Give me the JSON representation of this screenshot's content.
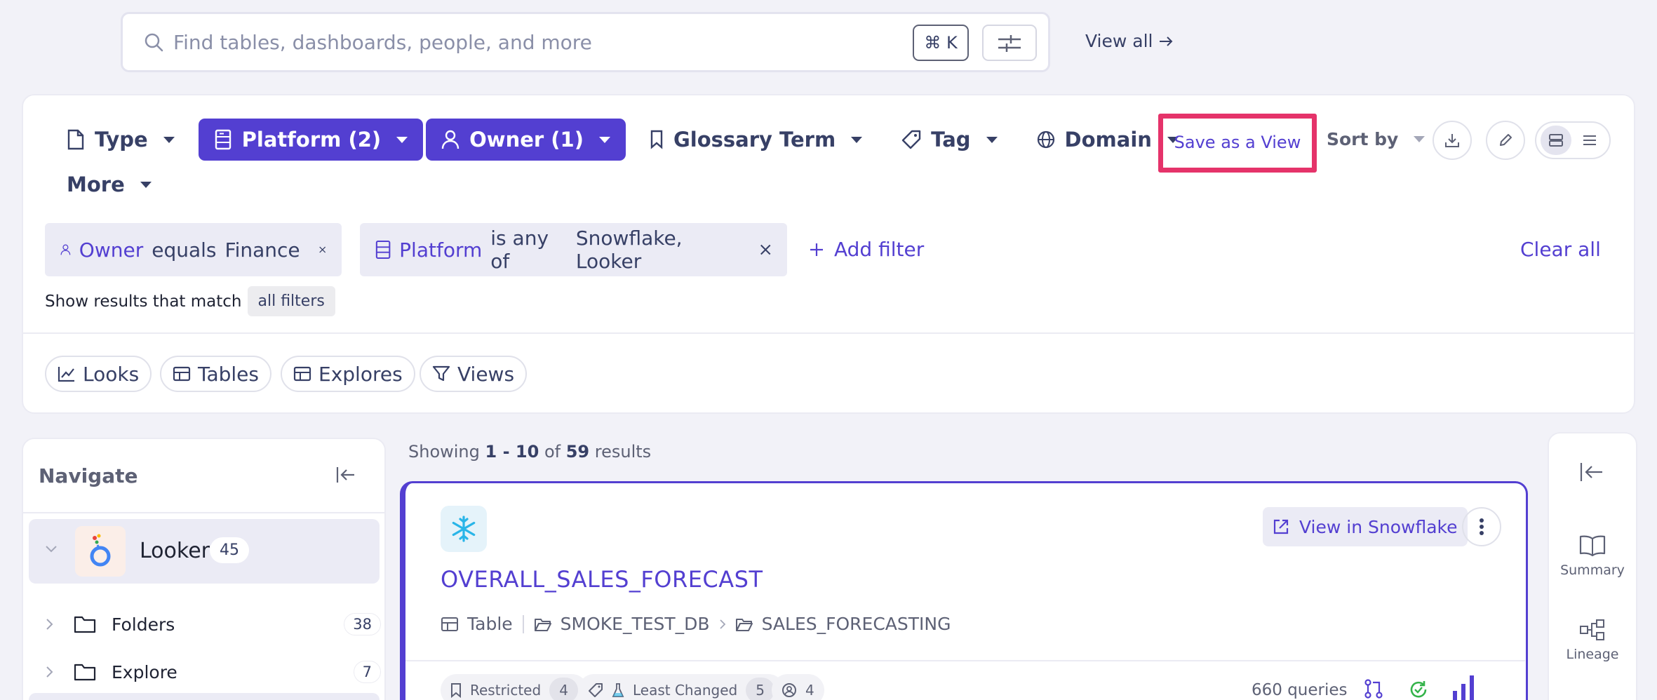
{
  "search": {
    "placeholder": "Find tables, dashboards, people, and more",
    "shortcut": "⌘ K",
    "view_all": "View all"
  },
  "filters": {
    "type": "Type",
    "platform": "Platform (2)",
    "owner": "Owner (1)",
    "glossary_term": "Glossary Term",
    "tag": "Tag",
    "domain": "Domain",
    "more": "More",
    "save_as_view": "Save as a View",
    "sort_by": "Sort by"
  },
  "active_filters": [
    {
      "field": "Owner",
      "operator": "equals",
      "value": "Finance"
    },
    {
      "field": "Platform",
      "operator": "is any of",
      "value": "Snowflake, Looker"
    }
  ],
  "add_filter": "Add filter",
  "clear_all": "Clear all",
  "match": {
    "prefix": "Show results that match",
    "mode": "all filters"
  },
  "subtypes": [
    "Looks",
    "Tables",
    "Explores",
    "Views"
  ],
  "navigate": {
    "title": "Navigate",
    "platform": {
      "label": "Looker",
      "count": "45"
    },
    "children": [
      {
        "label": "Folders",
        "count": "38"
      },
      {
        "label": "Explore",
        "count": "7"
      }
    ]
  },
  "results": {
    "prefix": "Showing",
    "range": "1 - 10",
    "of": "of",
    "total": "59",
    "suffix": "results"
  },
  "card": {
    "view_in": "View in Snowflake",
    "title": "OVERALL_SALES_FORECAST",
    "breadcrumb": [
      "Table",
      "SMOKE_TEST_DB",
      "SALES_FORECASTING"
    ],
    "pills": [
      {
        "label": "Restricted",
        "count": "4"
      },
      {
        "label": "Least Changed",
        "count": "5"
      },
      {
        "label": "",
        "count": "4"
      }
    ],
    "queries": "660 queries"
  },
  "side_panel": {
    "summary": "Summary",
    "lineage": "Lineage"
  },
  "colors": {
    "accent": "#533fd1",
    "highlight": "#e5336a",
    "background": "#f2f2f8"
  }
}
